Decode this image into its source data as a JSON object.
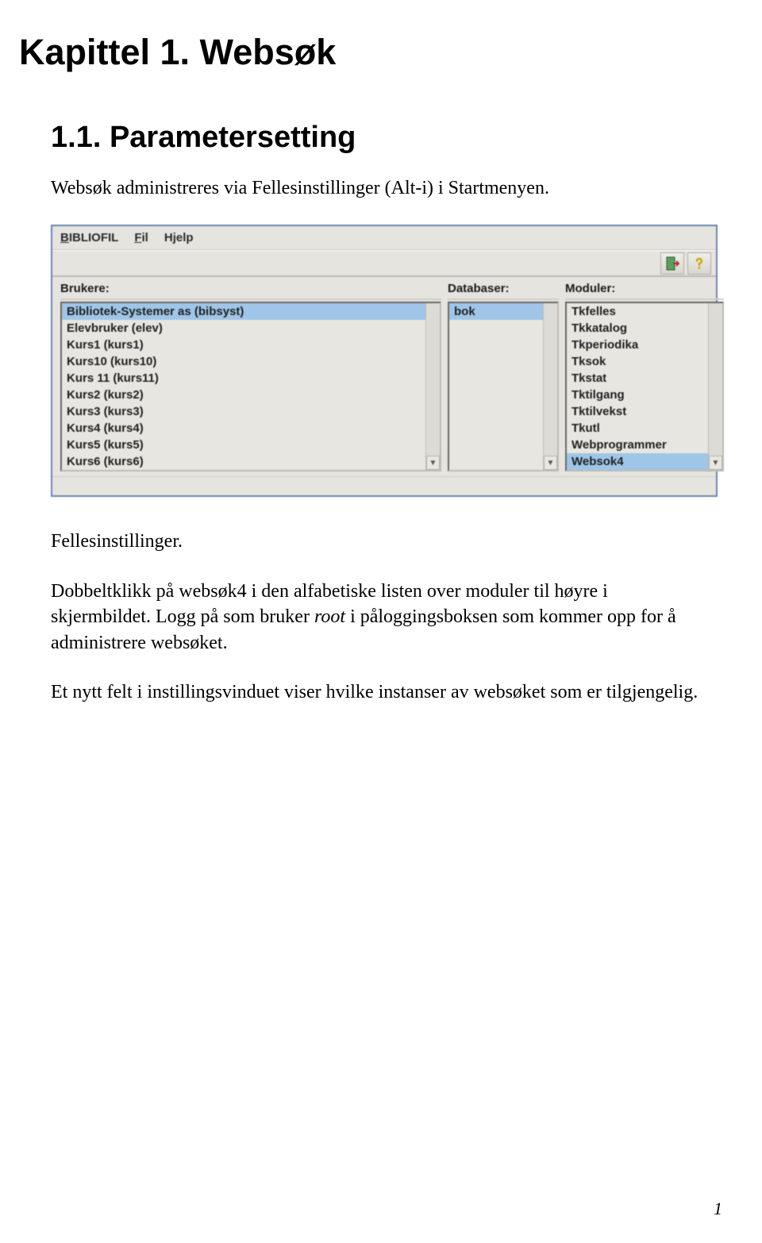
{
  "doc": {
    "chapter_title": "Kapittel 1. Websøk",
    "section_title": "1.1. Parametersetting",
    "p1_a": "Websøk administreres via ",
    "p1_b": "Fellesinstillinger (Alt-i)",
    "p1_c": " i Startmenyen.",
    "p2": "Fellesinstillinger.",
    "p3_a": "Dobbeltklikk på websøk4 i den alfabetiske listen over moduler til høyre i skjermbildet. Logg på som bruker ",
    "p3_b": "root",
    "p3_c": " i påloggingsboksen som kommer opp for å administrere websøket.",
    "p4": "Et nytt felt i instillingsvinduet viser hvilke instanser av websøket som er tilgjengelig.",
    "page_number": "1"
  },
  "app": {
    "menubar": {
      "bibliofil": "BIBLIOFIL",
      "fil_prefix": "F",
      "fil_rest": "il",
      "hjelp": "Hjelp"
    },
    "toolbar": {
      "close_title": "Close",
      "help_title": "Help"
    },
    "headers": {
      "brukere": "Brukere:",
      "databaser": "Databaser:",
      "moduler": "Moduler:"
    },
    "brukere": [
      "Bibliotek-Systemer as (bibsyst)",
      "Elevbruker (elev)",
      "Kurs1 (kurs1)",
      "Kurs10 (kurs10)",
      "Kurs 11 (kurs11)",
      "Kurs2 (kurs2)",
      "Kurs3 (kurs3)",
      "Kurs4 (kurs4)",
      "Kurs5 (kurs5)",
      "Kurs6 (kurs6)"
    ],
    "brukere_selected_index": 0,
    "databaser": [
      "bok"
    ],
    "databaser_selected_index": 0,
    "moduler": [
      "Tkfelles",
      "Tkkatalog",
      "Tkperiodika",
      "Tksok",
      "Tkstat",
      "Tktilgang",
      "Tktilvekst",
      "Tkutl",
      "Webprogrammer",
      "Websok4"
    ],
    "moduler_selected_index": 9
  }
}
